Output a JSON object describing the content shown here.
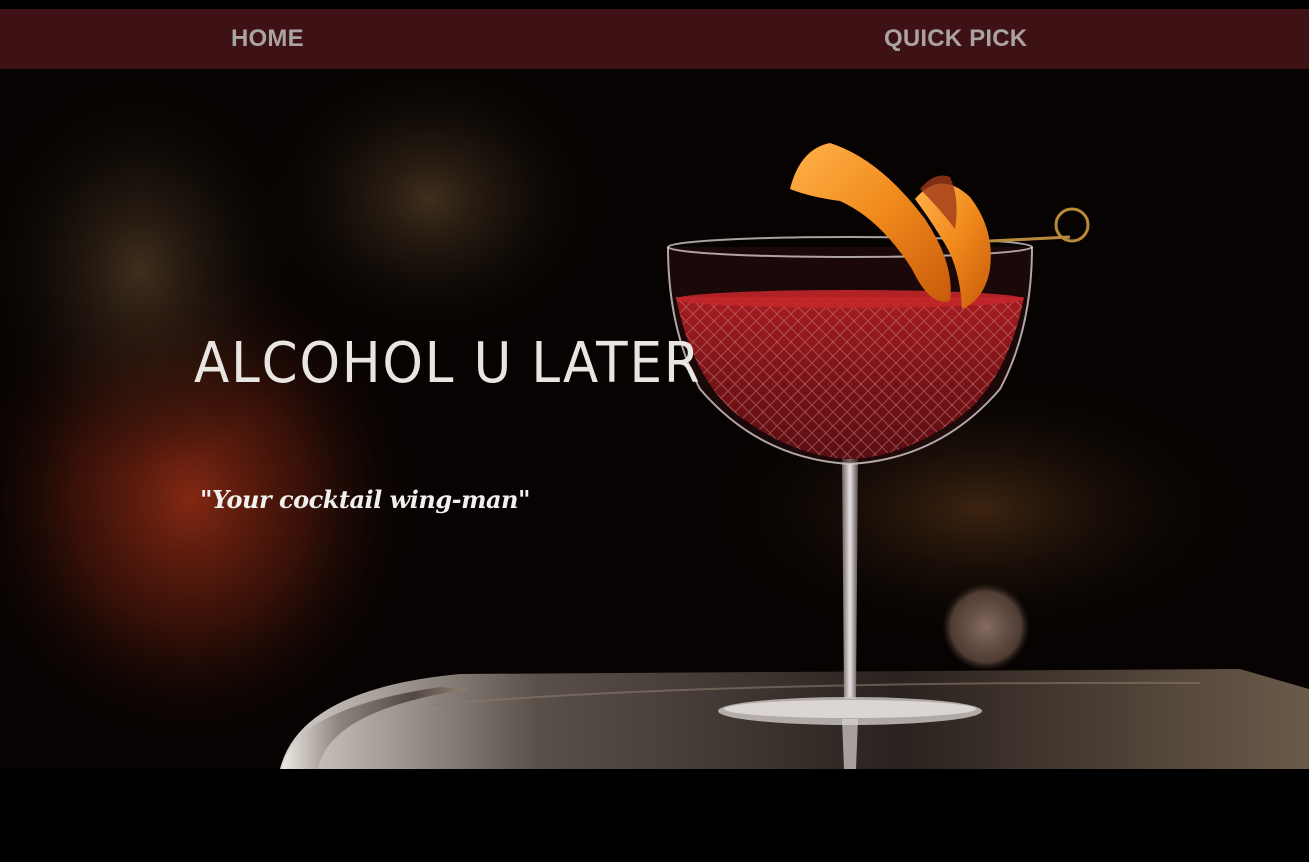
{
  "nav": {
    "home_label": "HOME",
    "quick_pick_label": "QUICK PICK"
  },
  "hero": {
    "title": "ALCOHOL U LATER",
    "tagline": "\"Your cocktail wing-man\"",
    "image_subject": "cocktail-coupe-glass-with-orange-peel"
  },
  "colors": {
    "navbar_bg": "#3e1214",
    "nav_text": "#a9a3a2",
    "page_bg": "#000000",
    "title_text": "#e9e6e2",
    "drink_red": "#7a1418",
    "garnish_orange": "#f08a1c"
  }
}
